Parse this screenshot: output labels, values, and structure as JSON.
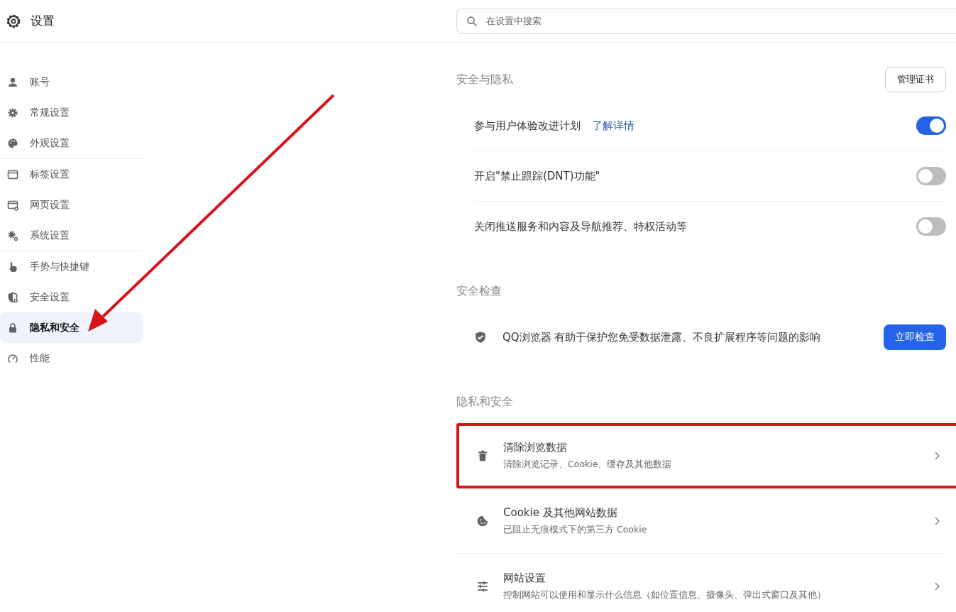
{
  "header": {
    "title": "设置",
    "search": {
      "placeholder": "在设置中搜索"
    }
  },
  "sidebar": {
    "groups": [
      [
        {
          "label": "账号",
          "selected": false
        },
        {
          "label": "常规设置",
          "selected": false
        },
        {
          "label": "外观设置",
          "selected": false
        }
      ],
      [
        {
          "label": "标签设置",
          "selected": false
        },
        {
          "label": "网页设置",
          "selected": false
        },
        {
          "label": "系统设置",
          "selected": false
        }
      ],
      [
        {
          "label": "手势与快捷键",
          "selected": false
        },
        {
          "label": "安全设置",
          "selected": false
        },
        {
          "label": "隐私和安全",
          "selected": true
        },
        {
          "label": "性能",
          "selected": false
        }
      ]
    ]
  },
  "sections": [
    {
      "title": "安全与隐私",
      "action": "管理证书",
      "rows": [
        {
          "kind": "toggle",
          "label": "参与用户体验改进计划",
          "link": "了解详情",
          "on": true
        },
        {
          "kind": "toggle",
          "label": "开启\"禁止跟踪(DNT)功能\"",
          "on": false
        },
        {
          "kind": "toggle",
          "label": "关闭推送服务和内容及导航推荐、特权活动等",
          "on": false
        }
      ]
    },
    {
      "title": "安全检查",
      "rows": [
        {
          "kind": "check",
          "label": "QQ浏览器 有助于保护您免受数据泄露、不良扩展程序等问题的影响",
          "button": "立即检查"
        }
      ]
    },
    {
      "title": "隐私和安全",
      "rows": [
        {
          "kind": "nav",
          "label": "清除浏览数据",
          "subtitle": "清除浏览记录、Cookie、缓存及其他数据",
          "highlighted": true
        },
        {
          "kind": "nav",
          "label": "Cookie 及其他网站数据",
          "subtitle": "已阻止无痕模式下的第三方 Cookie",
          "highlighted": false
        },
        {
          "kind": "nav",
          "label": "网站设置",
          "subtitle": "控制网站可以使用和显示什么信息（如位置信息、摄像头、弹出式窗口及其他）",
          "highlighted": false
        }
      ]
    }
  ],
  "annotation_arrow": true
}
